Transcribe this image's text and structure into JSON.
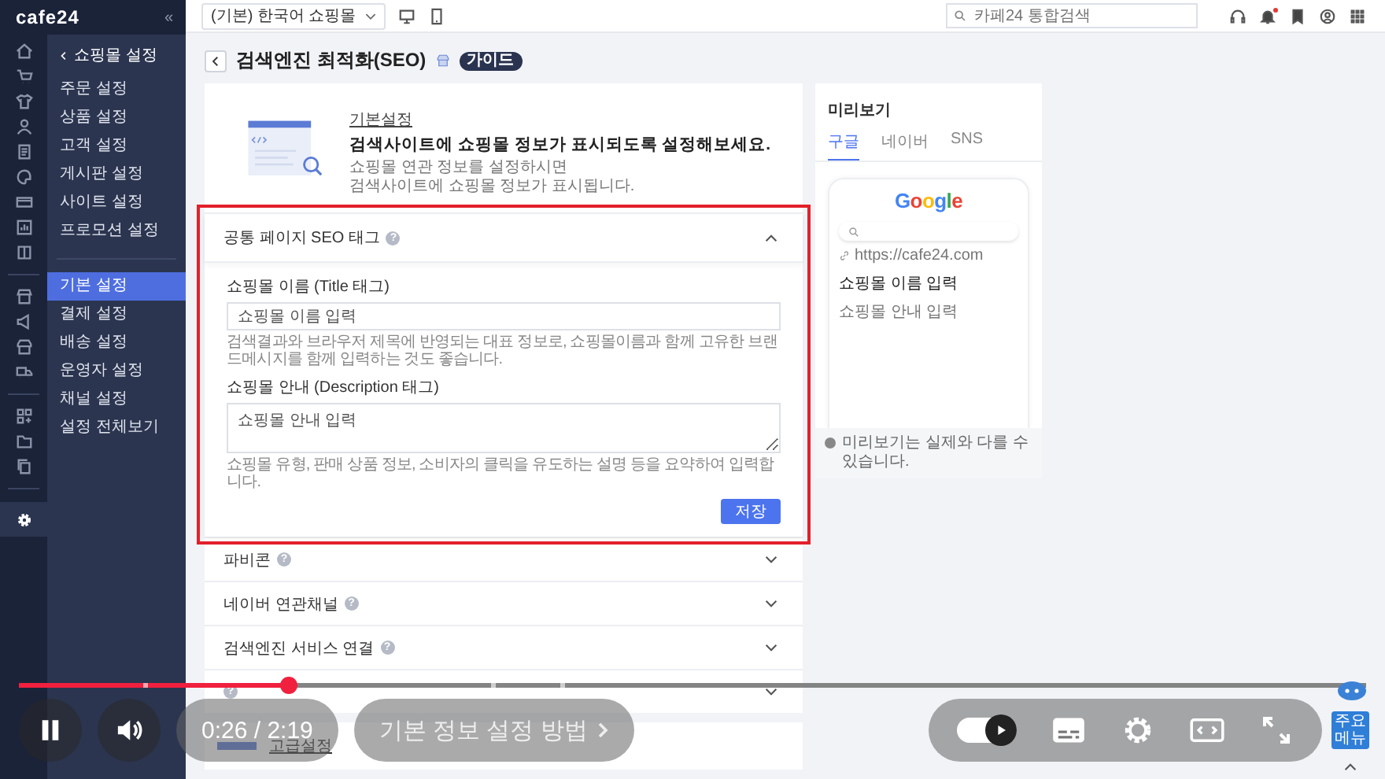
{
  "sidebar": {
    "logo": "cafe24",
    "collapse_label": "«",
    "back_label": "쇼핑몰 설정",
    "groups": [
      {
        "items": [
          {
            "label": "주문 설정",
            "selected": false
          },
          {
            "label": "상품 설정",
            "selected": false
          },
          {
            "label": "고객 설정",
            "selected": false
          },
          {
            "label": "게시판 설정",
            "selected": false
          },
          {
            "label": "사이트 설정",
            "selected": false
          },
          {
            "label": "프로모션 설정",
            "selected": false
          }
        ]
      },
      {
        "items": [
          {
            "label": "기본 설정",
            "selected": true
          },
          {
            "label": "결제 설정",
            "selected": false
          },
          {
            "label": "배송 설정",
            "selected": false
          },
          {
            "label": "운영자 설정",
            "selected": false
          },
          {
            "label": "채널 설정",
            "selected": false
          },
          {
            "label": "설정 전체보기",
            "selected": false
          }
        ]
      }
    ]
  },
  "topbar": {
    "shop_select": "(기본) 한국어 쇼핑몰",
    "search_placeholder": "카페24 통합검색",
    "has_notification": true
  },
  "page": {
    "title": "검색엔진 최적화(SEO)",
    "badge": "가이드"
  },
  "intro": {
    "label": "기본설정",
    "heading": "검색사이트에 쇼핑몰 정보가 표시되도록 설정해보세요.",
    "lines": [
      "쇼핑몰 연관 정보를 설정하시면",
      "검색사이트에 쇼핑몰 정보가 표시됩니다."
    ]
  },
  "sections": [
    {
      "title": "공통 페이지 SEO 태그",
      "help": "?",
      "expanded": true,
      "highlighted": true,
      "fields": [
        {
          "kind": "input",
          "label": "쇼핑몰 이름 (Title 태그)",
          "placeholder": "쇼핑몰 이름 입력",
          "hint": "검색결과와 브라우저 제목에 반영되는 대표 정보로, 쇼핑몰이름과 함께 고유한 브랜드메시지를 함께 입력하는 것도 좋습니다."
        },
        {
          "kind": "textarea",
          "label": "쇼핑몰 안내 (Description 태그)",
          "placeholder": "쇼핑몰 안내 입력",
          "hint": "쇼핑몰 유형, 판매 상품 정보, 소비자의 클릭을 유도하는 설명 등을 요약하여 입력합니다."
        }
      ],
      "save_label": "저장"
    },
    {
      "title": "파비콘",
      "help": "?",
      "expanded": false,
      "highlighted": false
    },
    {
      "title": "네이버 연관채널",
      "help": "?",
      "expanded": false,
      "highlighted": false
    },
    {
      "title": "검색엔진 서비스 연결",
      "help": "?",
      "expanded": false,
      "highlighted": false
    },
    {
      "help": "?",
      "expanded": false,
      "highlighted": false
    }
  ],
  "advanced": {
    "label": "고급설정"
  },
  "preview": {
    "title": "미리보기",
    "tabs": [
      {
        "label": "구글",
        "selected": true
      },
      {
        "label": "네이버",
        "selected": false
      },
      {
        "label": "SNS",
        "selected": false
      }
    ],
    "logo": "Google",
    "url": "https://cafe24.com",
    "result_title": "쇼핑몰 이름 입력",
    "result_desc": "쇼핑몰 안내 입력",
    "note": "미리보기는 실제와 다를 수 있습니다."
  },
  "player": {
    "progress": {
      "level": 0.2
    },
    "playing": true,
    "time": "0:26 / 2:19",
    "chapter": "기본 정보 설정 방법",
    "autoplay": {
      "on": true
    }
  },
  "floating_button": "주요 메뉴"
}
